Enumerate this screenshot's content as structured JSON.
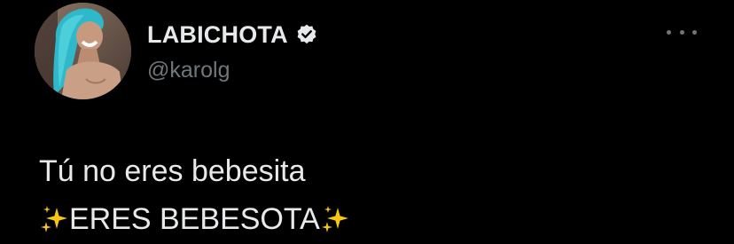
{
  "author": {
    "display_name": "LABICHOTA",
    "handle": "@karolg",
    "verified": true,
    "avatar_icon": "profile-photo-avatar"
  },
  "more_icon": "ellipsis-icon",
  "tweet": {
    "line1": "Tú no eres bebesita",
    "line2_text": "ERES BEBESOTA",
    "line2_emoji": "sparkles"
  },
  "colors": {
    "background": "#000000",
    "primary_text": "#e7e9ea",
    "secondary_text": "#71767b",
    "verified_badge": "#e7e9ea",
    "sparkle": "#f5c518"
  }
}
